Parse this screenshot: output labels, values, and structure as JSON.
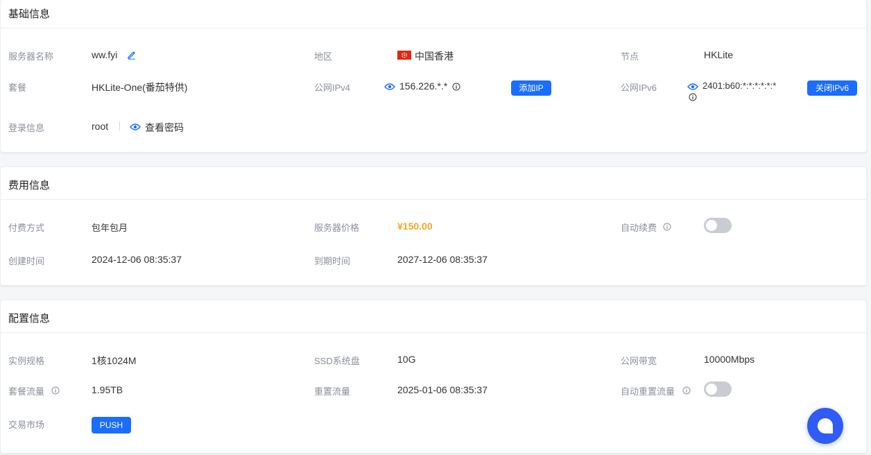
{
  "basic": {
    "title": "基础信息",
    "server_name_label": "服务器名称",
    "server_name": "ww.fyi",
    "region_label": "地区",
    "region": "中国香港",
    "node_label": "节点",
    "node": "HKLite",
    "plan_label": "套餐",
    "plan": "HKLite-One(番茄特供)",
    "ipv4_label": "公网IPv4",
    "ipv4": "156.226.*.*",
    "add_ip_label": "添加IP",
    "ipv6_label": "公网IPv6",
    "ipv6": "2401:b60:*:*:*:*:*:*",
    "close_ipv6_label": "关闭IPv6",
    "login_label": "登录信息",
    "login_user": "root",
    "view_password_label": "查看密码"
  },
  "billing": {
    "title": "费用信息",
    "pay_method_label": "付费方式",
    "pay_method": "包年包月",
    "price_label": "服务器价格",
    "price": "¥150.00",
    "auto_renew_label": "自动续费",
    "auto_renew_on": false,
    "created_label": "创建时间",
    "created": "2024-12-06 08:35:37",
    "expire_label": "到期时间",
    "expire": "2027-12-06 08:35:37"
  },
  "config": {
    "title": "配置信息",
    "spec_label": "实例规格",
    "spec": "1核1024M",
    "disk_label": "SSD系统盘",
    "disk": "10G",
    "bandwidth_label": "公网带宽",
    "bandwidth": "10000Mbps",
    "traffic_label": "套餐流量",
    "traffic": "1.95TB",
    "reset_label": "重置流量",
    "reset": "2025-01-06 08:35:37",
    "auto_reset_label": "自动重置流量",
    "auto_reset_on": false,
    "market_label": "交易市场",
    "push_label": "PUSH"
  },
  "colors": {
    "accent": "#1a6dff",
    "price": "#f5a623",
    "toggle_off": "#c9ccd2",
    "fab": "#2f5cf6"
  }
}
